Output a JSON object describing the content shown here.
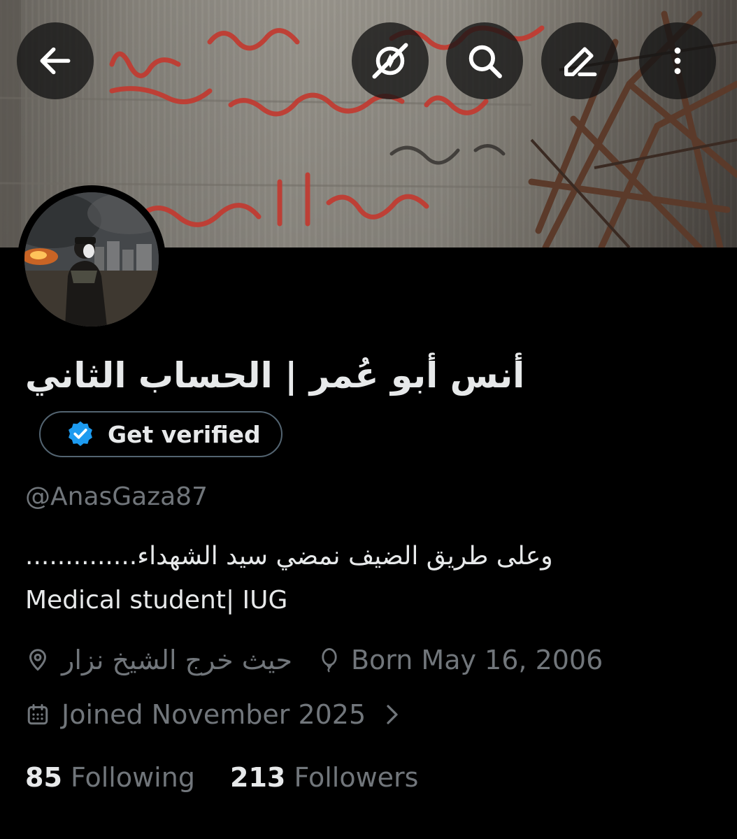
{
  "header": {
    "back_icon": "arrow-left-icon",
    "actions": [
      "sparkle-off-icon",
      "search-icon",
      "edit-icon",
      "more-vertical-icon"
    ]
  },
  "banner": {
    "description": "concrete wall with red Arabic graffiti and twisted metal debris"
  },
  "profile": {
    "display_name": "أنس أبو عُمر | الحساب الثاني",
    "verify_label": "Get verified",
    "handle": "@AnasGaza87",
    "bio_line1": "وعلى طريق الضيف نمضي سيد الشهداء..............",
    "bio_line2": "Medical student| IUG",
    "location": "حيث خرج الشيخ نزار",
    "birth": "Born May 16, 2006",
    "joined": "Joined November 2025",
    "following_count": "85",
    "following_label": "Following",
    "followers_count": "213",
    "followers_label": "Followers"
  },
  "colors": {
    "background": "#000000",
    "primary_text": "#e7e9ea",
    "secondary_text": "#71767b",
    "verified_badge": "#1d9bf0",
    "graffiti_red": "#c23a30"
  }
}
